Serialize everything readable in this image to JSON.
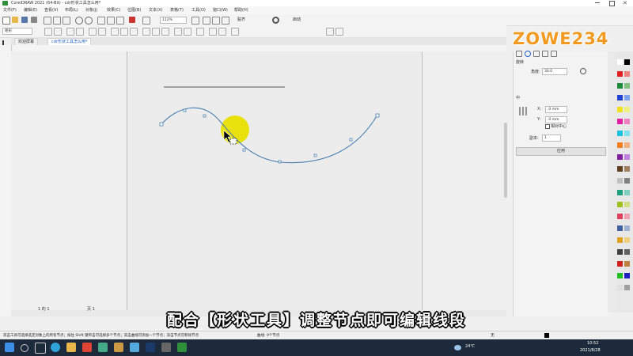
{
  "window": {
    "title": "CorelDRAW 2021 (64-Bit) - cdr形状工具怎么用*"
  },
  "menu": {
    "items": [
      "文件(F)",
      "编辑(E)",
      "查看(V)",
      "布局(L)",
      "对象(J)",
      "效果(C)",
      "位图(B)",
      "文本(X)",
      "表格(T)",
      "工具(O)",
      "窗口(W)",
      "帮助(H)"
    ]
  },
  "toolbar": {
    "zoom": "112%",
    "snap_label": "贴齐",
    "launch_label": "启动",
    "shape_select": "矩形"
  },
  "tabs": [
    {
      "label": "欢迎屏幕"
    },
    {
      "label": "cdr形状工具怎么用*"
    }
  ],
  "docker": {
    "section_rotate": "旋转",
    "angle_label": "角度:",
    "angle_value": "30.0",
    "section_center": "中",
    "x_label": "X:",
    "x_value": ".0 mm",
    "y_label": "Y:",
    "y_value": ".0 mm",
    "relative_center": "相对中心",
    "copies_label": "副本:",
    "copies_value": "1",
    "apply_label": "应用"
  },
  "page_nav": {
    "counter": "1 的 1",
    "page_label": "页 1"
  },
  "subtitle": "配合【形状工具】调整节点即可编辑线段",
  "logo": {
    "text": "ZOWE234"
  },
  "status": {
    "hint": "双击工具可选择选定对象上的所有节点；按住 Shift 键单击可选择多个节点；双击曲线可添加一个节点；双击节点可移除节点",
    "curve_info": "曲线: 9个节点",
    "fill_none": "无"
  },
  "taskbar": {
    "weather": "24℃",
    "time": "10:52",
    "date": "2021/8/28"
  },
  "colors": {
    "accent": "#2060c0",
    "curve": "#4a7fb0",
    "highlight": "#e8e000",
    "taskbar": "#1c2a3c"
  }
}
